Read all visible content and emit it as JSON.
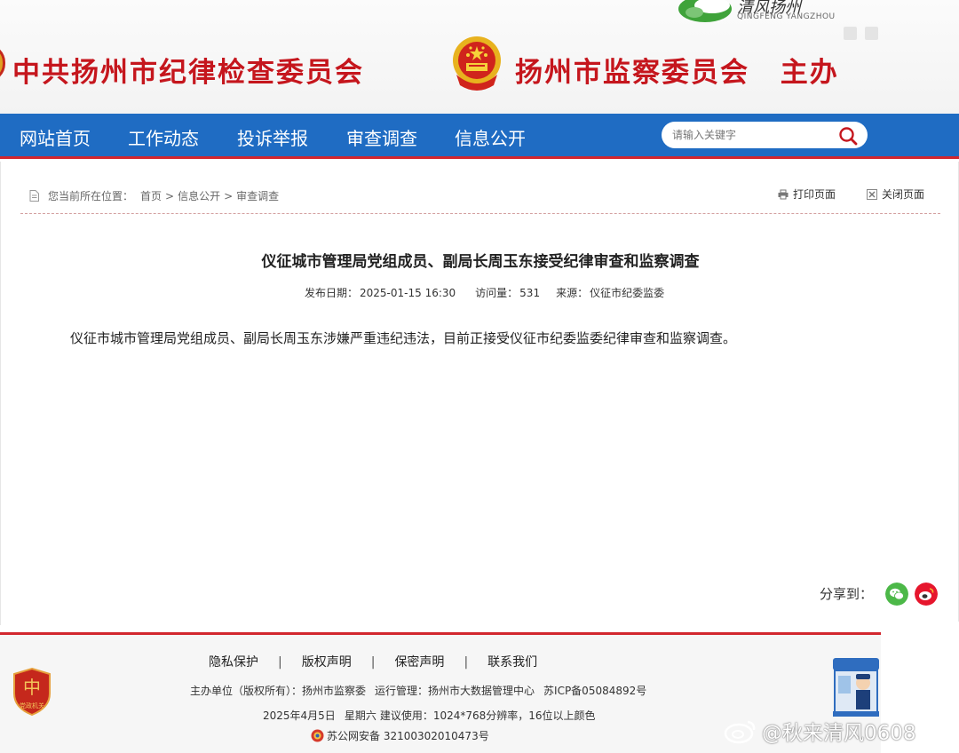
{
  "header": {
    "org1": "中共扬州市纪律检查委员会",
    "org2": "扬州市监察委员会",
    "org2_suffix": "主办",
    "brand_cn": "清风扬州",
    "brand_en": "QINGFENG YANGZHOU"
  },
  "nav": {
    "items": [
      "网站首页",
      "工作动态",
      "投诉举报",
      "审查调查",
      "信息公开"
    ],
    "search_placeholder": "请输入关键字"
  },
  "breadcrumb": {
    "prefix": "您当前所在位置：",
    "home": "首页",
    "sep": ">",
    "level1": "信息公开",
    "level2": "审查调查"
  },
  "tools": {
    "print": "打印页面",
    "close": "关闭页面"
  },
  "article": {
    "title": "仪征城市管理局党组成员、副局长周玉东接受纪律审查和监察调查",
    "date_label": "发布日期：",
    "date": "2025-01-15 16:30",
    "views_label": "访问量：",
    "views": "531",
    "source_label": "来源：",
    "source": "仪征市纪委监委",
    "body": "仪征市城市管理局党组成员、副局长周玉东涉嫌严重违纪违法，目前正接受仪征市纪委监委纪律审查和监察调查。"
  },
  "share": {
    "label": "分享到："
  },
  "footer": {
    "links": [
      "隐私保护",
      "版权声明",
      "保密声明",
      "联系我们"
    ],
    "link_sep": "|",
    "host": "主办单位（版权所有）：扬州市监察委",
    "operator": "运行管理：扬州市大数据管理中心",
    "icp": "苏ICP备05084892号",
    "date": "2025年4月5日",
    "weekday": "星期六",
    "advice": "建议使用：1024*768分辨率，16位以上颜色",
    "police_record": "苏公网安备 32100302010473号",
    "badge_text": "党政机关"
  },
  "watermark": {
    "text": "@秋来清风0608"
  },
  "colors": {
    "nav_blue": "#1f6cc3",
    "accent_red": "#d2272e",
    "title_red": "#c5161d",
    "wechat_green": "#4cb848",
    "weibo_red": "#e6162d"
  }
}
